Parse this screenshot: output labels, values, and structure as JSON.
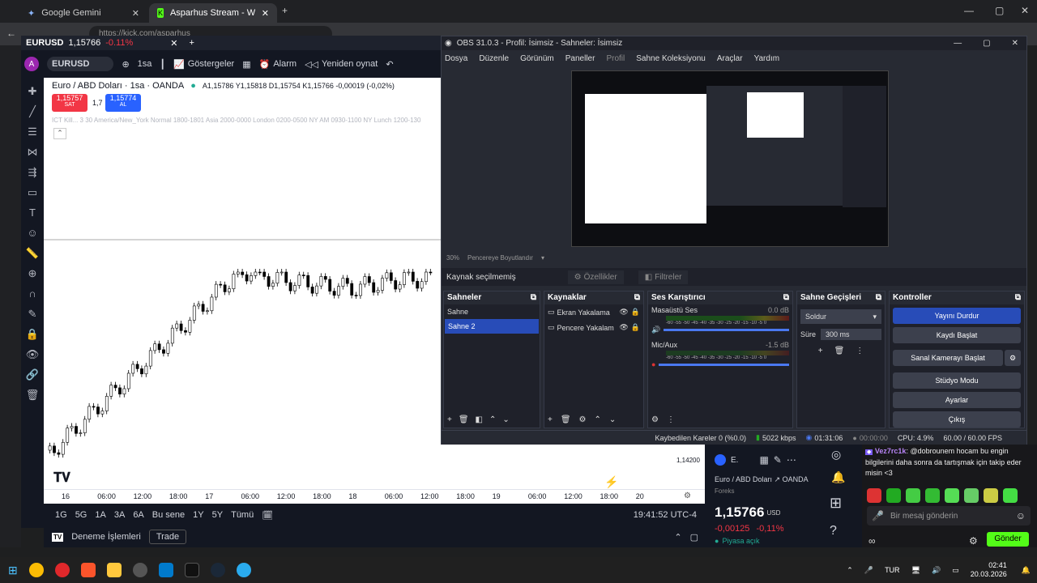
{
  "browser": {
    "tabs": [
      {
        "label": "Google Gemini"
      },
      {
        "label": "Asparhus Stream - Watch Live o"
      }
    ],
    "url": "https://kick.com/asparhus"
  },
  "tradingview": {
    "window_symbol": "EURUSD",
    "window_price": "1,15766",
    "window_change": "-0.11%",
    "symbol_input": "EURUSD",
    "timeframe": "1sa",
    "indicators_label": "Göstergeler",
    "alarm_label": "Alarm",
    "replay_label": "Yeniden oynat",
    "legend_title": "Euro / ABD Doları · 1sa · OANDA",
    "ohlc": "A1,15786 Y1,15818 D1,15754 K1,15766 -0,00019 (-0,02%)",
    "sell_price": "1,15757",
    "sell_label": "SAT",
    "spread": "1,7",
    "buy_price": "1,15774",
    "buy_label": "AL",
    "indicator_text": "ICT Kill... 3 30 America/New_York Normal 1800-1801 Asia 2000-0000 London 0200-0500 NY AM 0930-1100 NY Lunch 1200-130",
    "price_tick": "1,14200",
    "time_ticks": [
      "16",
      "06:00",
      "12:00",
      "18:00",
      "17",
      "06:00",
      "12:00",
      "18:00",
      "18",
      "06:00",
      "12:00",
      "18:00",
      "19",
      "06:00",
      "12:00",
      "18:00",
      "20"
    ],
    "ranges": [
      "1G",
      "5G",
      "1A",
      "3A",
      "6A",
      "Bu sene",
      "1Y",
      "5Y",
      "Tümü"
    ],
    "clock": "19:41:52 UTC-4",
    "demo_label": "Deneme İşlemleri",
    "trade_label": "Trade",
    "panel_short": "E.",
    "panel_name": "Euro / ABD Doları",
    "panel_exchange": "OANDA",
    "panel_type": "Foreks",
    "panel_price": "1,15766",
    "panel_currency": "USD",
    "panel_change": "-0,00125",
    "panel_change_pct": "-0,11%",
    "market_status": "Piyasa açık"
  },
  "obs": {
    "title": "OBS 31.0.3 - Profil: İsimsiz - Sahneler: İsimsiz",
    "menu": [
      "Dosya",
      "Düzenle",
      "Görünüm",
      "Paneller",
      "Profil",
      "Sahne Koleksiyonu",
      "Araçlar",
      "Yardım"
    ],
    "zoom": "30%",
    "resize_label": "Pencereye Boyutlandır",
    "no_source": "Kaynak seçilmemiş",
    "properties": "Özellikler",
    "filters": "Filtreler",
    "scenes_title": "Sahneler",
    "scenes": [
      "Sahne",
      "Sahne 2"
    ],
    "sources_title": "Kaynaklar",
    "sources": [
      "Ekran Yakalama",
      "Pencere Yakalam"
    ],
    "mixer_title": "Ses Karıştırıcı",
    "desktop_audio": "Masaüstü Ses",
    "desktop_db": "0.0 dB",
    "mic_audio": "Mic/Aux",
    "mic_db": "-1.5 dB",
    "meter_scale": "-60 -55 -50 -45 -40 -35 -30 -25 -20 -15 -10 -5 0",
    "transitions_title": "Sahne Geçişleri",
    "transition": "Soldur",
    "duration_label": "Süre",
    "duration": "300 ms",
    "controls_title": "Kontroller",
    "controls": [
      "Yayını Durdur",
      "Kaydı Başlat",
      "Sanal Kamerayı Başlat",
      "Stüdyo Modu",
      "Ayarlar",
      "Çıkış"
    ],
    "dropped": "Kaybedilen Kareler 0 (%0.0)",
    "bitrate": "5022 kbps",
    "stream_time": "01:31:06",
    "rec_time": "00:00:00",
    "cpu": "CPU: 4.9%",
    "fps": "60.00 / 60.00 FPS"
  },
  "chat": {
    "user": "Vez7rc1k",
    "message": "@dobrounem hocam bu engin bilgilerini daha sonra da tartışmak için takip eder misin <3",
    "input_placeholder": "Bir mesaj gönderin",
    "send_label": "Gönder"
  },
  "taskbar": {
    "lang": "TUR",
    "time": "02:41",
    "date": "20.03.2026"
  },
  "colors": {
    "sell": "#f23645",
    "buy": "#2962ff",
    "obs_primary": "#284cb8",
    "down": "#f23645",
    "up": "#22ab94",
    "send": "#53fc18"
  }
}
